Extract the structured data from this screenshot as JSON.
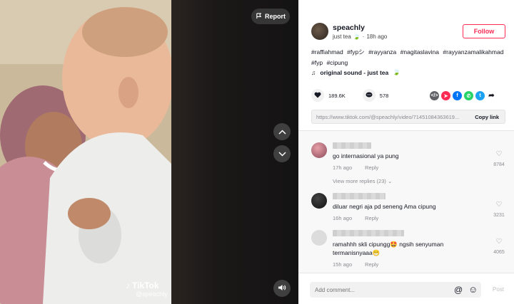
{
  "video": {
    "report_label": "Report",
    "watermark_brand": "TikTok",
    "watermark_handle": "@speachly"
  },
  "post": {
    "username": "speachly",
    "sound_name": "just tea",
    "time_ago": "18h ago",
    "follow_label": "Follow",
    "hashtags": [
      "#raffiahmad",
      "#fypシ",
      "#rayyanza",
      "#nagitaslavina",
      "#rayyanzamalikahmad",
      "#fyp",
      "#cipung"
    ],
    "sound_line": "original sound - just tea"
  },
  "stats": {
    "likes": "189.6K",
    "comments": "578"
  },
  "share_icons": [
    {
      "name": "embed-icon",
      "color": "#5f6066"
    },
    {
      "name": "send-icon",
      "color": "#fe2c55"
    },
    {
      "name": "facebook-icon",
      "color": "#0075fa"
    },
    {
      "name": "whatsapp-icon",
      "color": "#25d366"
    },
    {
      "name": "twitter-icon",
      "color": "#1da1f2"
    },
    {
      "name": "share-arrow-icon",
      "color": "#161823"
    }
  ],
  "link": {
    "url": "https://www.tiktok.com/@speachly/video/71451084363619...",
    "copy_label": "Copy link"
  },
  "comments": [
    {
      "text": "go internasional ya pung",
      "time": "17h ago",
      "reply": "Reply",
      "likes": "8784"
    },
    {
      "text": "diluar negri aja pd seneng Ama cipung",
      "time": "16h ago",
      "reply": "Reply",
      "likes": "3231"
    },
    {
      "text": "ramahhh skli cipungg🤩 ngsih senyuman termanisnyaaa😁",
      "time": "15h ago",
      "reply": "Reply",
      "likes": "4065"
    }
  ],
  "view_more_replies": "View more replies (23)",
  "composer": {
    "placeholder": "Add comment...",
    "post_label": "Post"
  }
}
